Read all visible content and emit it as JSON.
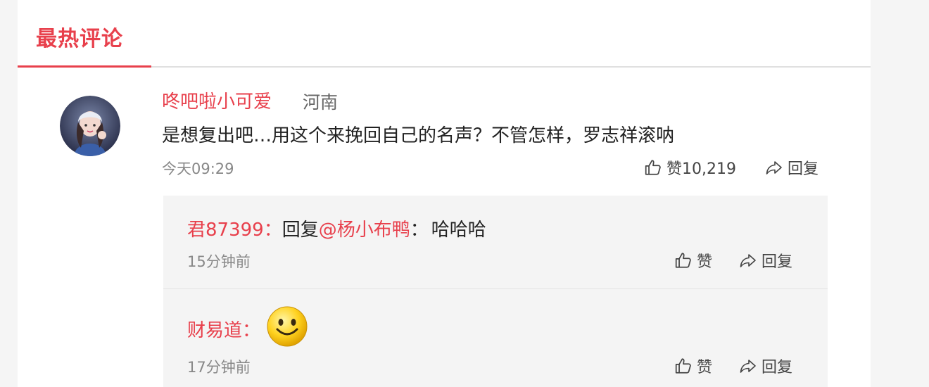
{
  "tab": {
    "title": "最热评论"
  },
  "comment": {
    "author": "咚吧啦小可爱",
    "location": "河南",
    "text": "是想复出吧…用这个来挽回自己的名声？不管怎样，罗志祥滚呐",
    "time": "今天09:29",
    "like_label": "赞10,219",
    "reply_label": "回复"
  },
  "replies": [
    {
      "author": "君87399：",
      "prefix": "回复",
      "mention": "@杨小布鸭",
      "colon": "：",
      "text": "哈哈哈",
      "time": "15分钟前",
      "like_label": "赞",
      "reply_label": "回复"
    },
    {
      "author": "财易道：",
      "emoji": "smiley-emoji",
      "time": "17分钟前",
      "like_label": "赞",
      "reply_label": "回复"
    }
  ],
  "colors": {
    "accent": "#e8404c",
    "reply_bg": "#f4f4f4",
    "meta": "#888888"
  },
  "icons": {
    "like": "thumbs-up-icon",
    "reply": "share-arrow-icon"
  }
}
